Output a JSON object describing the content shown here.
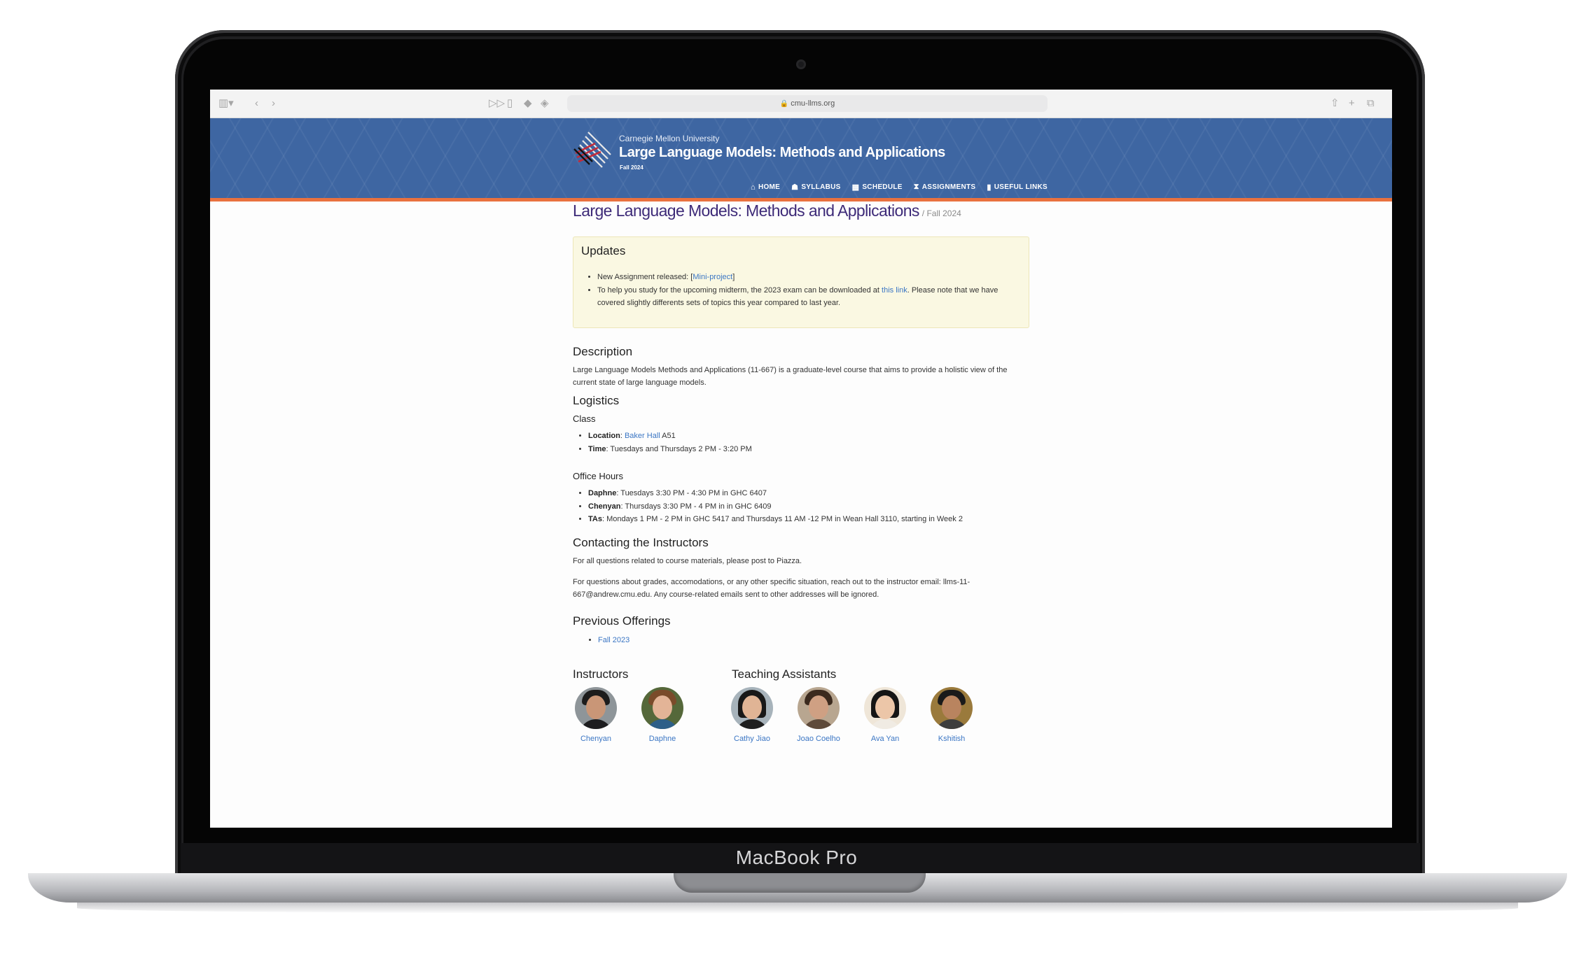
{
  "device": {
    "label": "MacBook Pro"
  },
  "browser": {
    "url": "cmu-llms.org"
  },
  "site": {
    "university": "Carnegie Mellon University",
    "title": "Large Language Models: Methods and Applications",
    "term": "Fall 2024",
    "nav": [
      {
        "icon": "home-icon",
        "glyph": "⌂",
        "label": "HOME"
      },
      {
        "icon": "syllabus-icon",
        "glyph": "☗",
        "label": "SYLLABUS"
      },
      {
        "icon": "calendar-icon",
        "glyph": "▦",
        "label": "SCHEDULE"
      },
      {
        "icon": "hourglass-icon",
        "glyph": "⧗",
        "label": "ASSIGNMENTS"
      },
      {
        "icon": "bookmark-icon",
        "glyph": "▮",
        "label": "USEFUL LINKS"
      }
    ]
  },
  "page": {
    "title": "Large Language Models: Methods and Applications",
    "subtitle": "/ Fall 2024"
  },
  "updates": {
    "heading": "Updates",
    "item1_prefix": "New Assignment released: [",
    "item1_link": "Mini-project",
    "item1_suffix": "]",
    "item2_prefix": "To help you study for the upcoming midterm, the 2023 exam can be downloaded at ",
    "item2_link": "this link",
    "item2_suffix": ". Please note that we have covered slightly differents sets of topics this year compared to last year."
  },
  "description": {
    "heading": "Description",
    "text": "Large Language Models Methods and Applications (11-667) is a graduate-level course that aims to provide a holistic view of the current state of large language models."
  },
  "logistics": {
    "heading": "Logistics",
    "class_heading": "Class",
    "location_label": "Location",
    "location_link": "Baker Hall",
    "location_room": " A51",
    "time_label": "Time",
    "time_value": ": Tuesdays and Thursdays 2 PM - 3:20 PM",
    "office_heading": "Office Hours",
    "office": [
      {
        "name": "Daphne",
        "text": ": Tuesdays 3:30 PM - 4:30 PM in GHC 6407"
      },
      {
        "name": "Chenyan",
        "text": ": Thursdays 3:30 PM - 4 PM in in GHC 6409"
      },
      {
        "name": "TAs",
        "text": ": Mondays 1 PM - 2 PM in GHC 5417 and Thursdays 11 AM -12 PM in Wean Hall 3110, starting in Week 2"
      }
    ]
  },
  "contact": {
    "heading": "Contacting the Instructors",
    "p1": "For all questions related to course materials, please post to Piazza.",
    "p2": "For questions about grades, accomodations, or any other specific situation, reach out to the instructor email: llms-11-667@andrew.cmu.edu. Any course-related emails sent to other addresses will be ignored."
  },
  "previous": {
    "heading": "Previous Offerings",
    "items": [
      "Fall 2023"
    ]
  },
  "people": {
    "instructors_heading": "Instructors",
    "tas_heading": "Teaching Assistants",
    "instructors": [
      "Chenyan",
      "Daphne"
    ],
    "tas": [
      "Cathy Jiao",
      "Joao Coelho",
      "Ava Yan",
      "Kshitish"
    ]
  }
}
